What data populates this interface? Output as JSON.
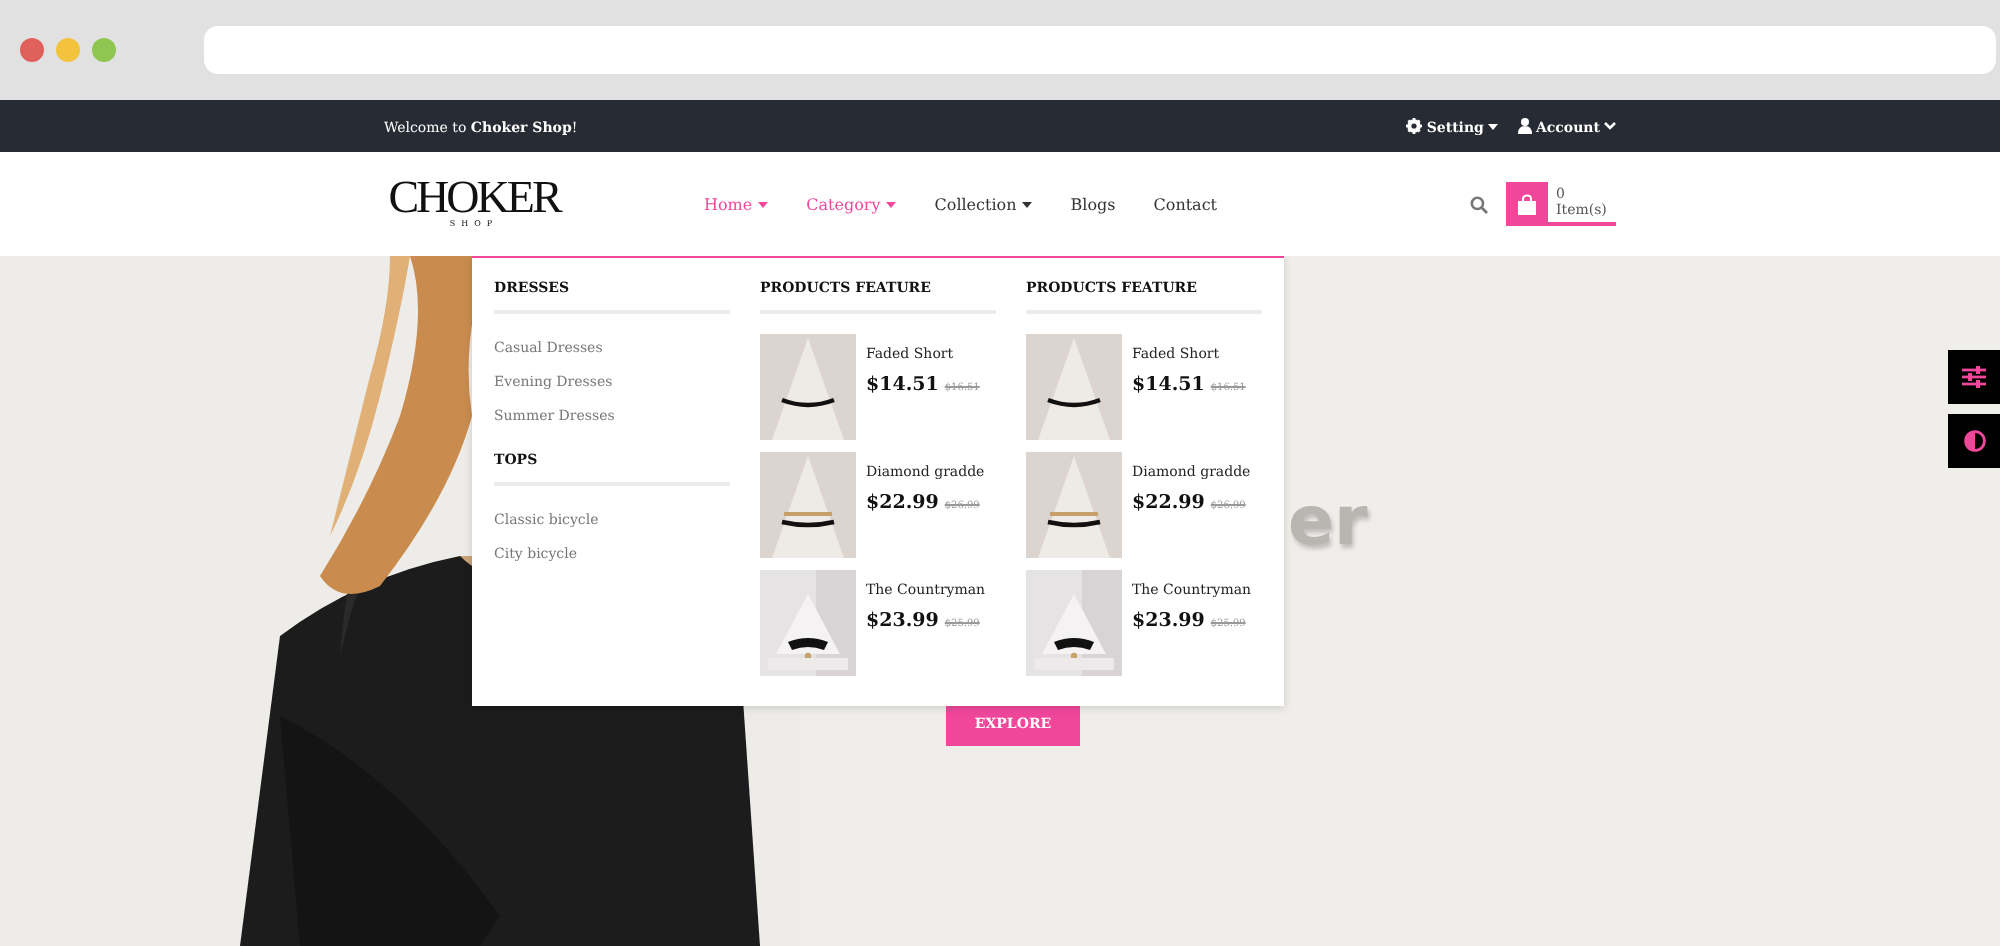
{
  "topbar": {
    "welcome": "Welcome to **Choker Shop**!",
    "setting": "Setting",
    "account": "Account"
  },
  "header": {
    "logo": "CHOKER",
    "logo_sub": "SHOP",
    "nav": [
      {
        "label": "Home",
        "highlighted": true,
        "dropdown": true
      },
      {
        "label": "Category",
        "highlighted": true,
        "dropdown": true
      },
      {
        "label": "Collection",
        "highlighted": false,
        "dropdown": true
      },
      {
        "label": "Blogs",
        "highlighted": false,
        "dropdown": false
      },
      {
        "label": "Contact",
        "highlighted": false,
        "dropdown": false
      }
    ],
    "cart": "0 Item(s)"
  },
  "mega_menu": {
    "link_groups": [
      {
        "title": "DRESSES",
        "links": [
          "Casual Dresses",
          "Evening Dresses",
          "Summer Dresses"
        ]
      },
      {
        "title": "TOPS",
        "links": [
          "Classic bicycle",
          "City bicycle"
        ]
      }
    ],
    "product_columns": [
      {
        "title": "PRODUCTS FEATURE",
        "products": [
          {
            "name": "Faded Short",
            "price": "$14.51",
            "old_price": "$16.51"
          },
          {
            "name": "Diamond gradde",
            "price": "$22.99",
            "old_price": "$26.99"
          },
          {
            "name": "The Countryman",
            "price": "$23.99",
            "old_price": "$25.99"
          }
        ]
      },
      {
        "title": "PRODUCTS FEATURE",
        "products": [
          {
            "name": "Faded Short",
            "price": "$14.51",
            "old_price": "$16.51"
          },
          {
            "name": "Diamond gradde",
            "price": "$22.99",
            "old_price": "$26.99"
          },
          {
            "name": "The Countryman",
            "price": "$23.99",
            "old_price": "$25.99"
          }
        ]
      }
    ]
  },
  "hero": {
    "heading_fragment": "er",
    "button": "EXPLORE"
  }
}
